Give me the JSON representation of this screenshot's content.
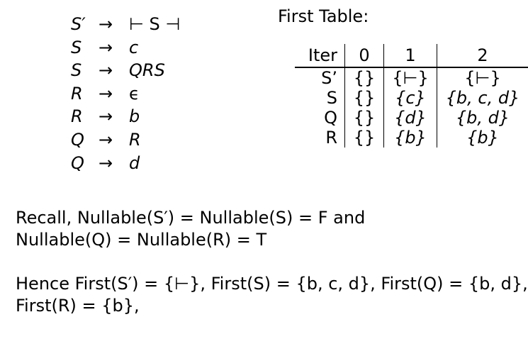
{
  "grammar": [
    {
      "lhs": "S′",
      "arrow": "→",
      "rhs": "⊢ S ⊣",
      "rhs_italic": false
    },
    {
      "lhs": "S",
      "arrow": "→",
      "rhs": "c",
      "rhs_italic": true
    },
    {
      "lhs": "S",
      "arrow": "→",
      "rhs": "QRS",
      "rhs_italic": true
    },
    {
      "lhs": "R",
      "arrow": "→",
      "rhs": "ϵ",
      "rhs_italic": false
    },
    {
      "lhs": "R",
      "arrow": "→",
      "rhs": "b",
      "rhs_italic": true
    },
    {
      "lhs": "Q",
      "arrow": "→",
      "rhs": "R",
      "rhs_italic": true
    },
    {
      "lhs": "Q",
      "arrow": "→",
      "rhs": "d",
      "rhs_italic": true
    }
  ],
  "first_table": {
    "title": "First Table:",
    "headers": [
      "Iter",
      "0",
      "1",
      "2"
    ],
    "rows": [
      [
        "S’",
        "{}",
        "{⊢}",
        "{⊢}"
      ],
      [
        "S",
        "{}",
        "{c}",
        "{b, c, d}"
      ],
      [
        "Q",
        "{}",
        "{d}",
        "{b, d}"
      ],
      [
        "R",
        "{}",
        "{b}",
        "{b}"
      ]
    ]
  },
  "recall": {
    "line1": "Recall, Nullable(S′) = Nullable(S) = F and",
    "line2": "Nullable(Q) = Nullable(R) = T"
  },
  "hence": {
    "line1": "Hence First(S′) = {⊢}, First(S) = {b, c, d}, First(Q) = {b, d},",
    "line2": "First(R) = {b},"
  }
}
